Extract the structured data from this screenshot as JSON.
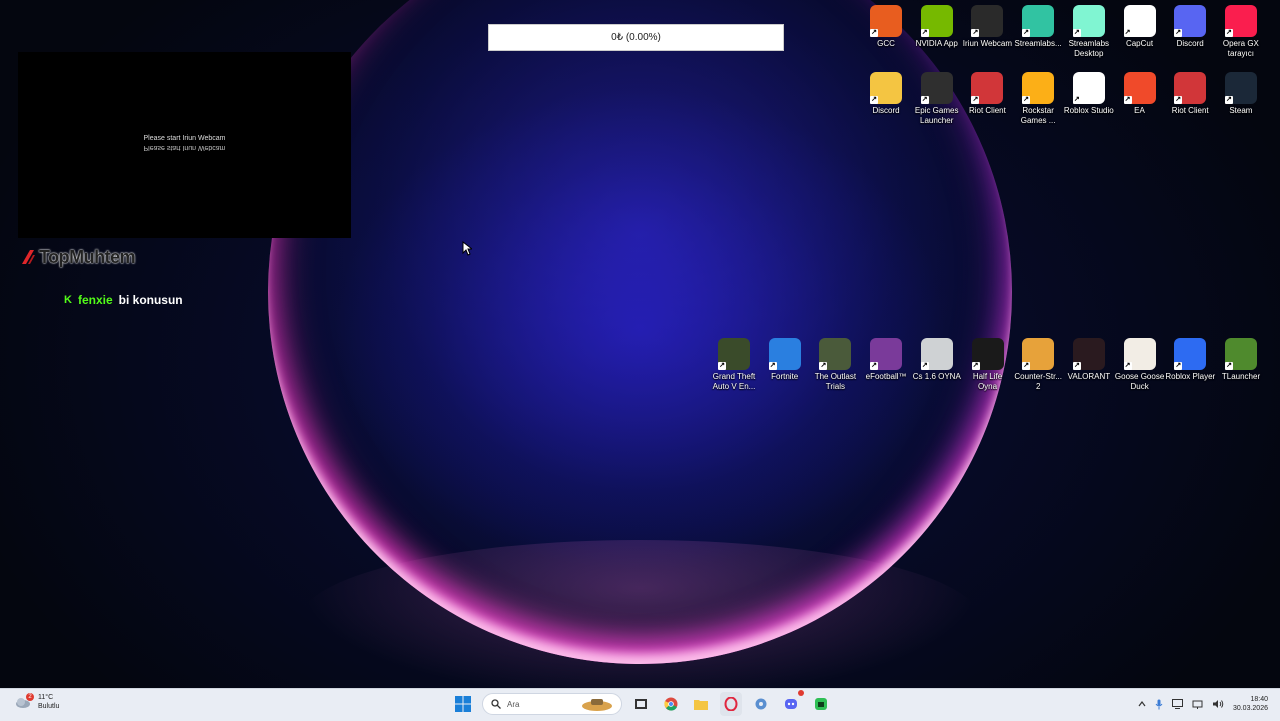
{
  "progress": {
    "text": "0₺ (0.00%)"
  },
  "webcam_overlay": {
    "message": "Please start Iriun Webcam"
  },
  "brand": {
    "name": "TopMuhtem"
  },
  "chat": {
    "username": "fenxie",
    "message": "bi konusun"
  },
  "desktop_icons_top": [
    {
      "label": "GCC",
      "icon": "gcc-icon",
      "color": "#e85d1f"
    },
    {
      "label": "NVIDIA App",
      "icon": "nvidia-icon",
      "color": "#76b900"
    },
    {
      "label": "Iriun Webcam",
      "icon": "iriun-webcam-icon",
      "color": "#2a2a2a"
    },
    {
      "label": "Streamlabs...",
      "icon": "streamlabs-icon",
      "color": "#31c3a2"
    },
    {
      "label": "Streamlabs Desktop",
      "icon": "streamlabs-desktop-icon",
      "color": "#80f5d2"
    },
    {
      "label": "CapCut",
      "icon": "capcut-icon",
      "color": "#ffffff"
    },
    {
      "label": "Discord",
      "icon": "discord-icon",
      "color": "#5865f2"
    },
    {
      "label": "Opera GX tarayıcı",
      "icon": "opera-gx-icon",
      "color": "#fa1e4e"
    }
  ],
  "desktop_icons_row2": [
    {
      "label": "Discord",
      "icon": "folder-icon",
      "color": "#f4c542"
    },
    {
      "label": "Epic Games Launcher",
      "icon": "epic-games-icon",
      "color": "#2f2f2f"
    },
    {
      "label": "Riot Client",
      "icon": "riot-client-icon",
      "color": "#d13639"
    },
    {
      "label": "Rockstar Games ...",
      "icon": "rockstar-icon",
      "color": "#fcaf17"
    },
    {
      "label": "Roblox Studio",
      "icon": "roblox-studio-icon",
      "color": "#ffffff"
    },
    {
      "label": "EA",
      "icon": "ea-icon",
      "color": "#f04a2a"
    },
    {
      "label": "Riot Client",
      "icon": "riot-client-icon",
      "color": "#d13639"
    },
    {
      "label": "Steam",
      "icon": "steam-icon",
      "color": "#1b2838"
    }
  ],
  "desktop_icons_games": [
    {
      "label": "Grand Theft Auto V En...",
      "icon": "gta5-icon",
      "color": "#3a4b2a"
    },
    {
      "label": "Fortnite",
      "icon": "fortnite-icon",
      "color": "#2a7fe0"
    },
    {
      "label": "The Outlast Trials",
      "icon": "outlast-icon",
      "color": "#4a5a3a"
    },
    {
      "label": "eFootball™",
      "icon": "efootball-icon",
      "color": "#7a3a9a"
    },
    {
      "label": "Cs 1.6 OYNA",
      "icon": "cs16-icon",
      "color": "#cfd2d4"
    },
    {
      "label": "Half Life Oyna",
      "icon": "half-life-icon",
      "color": "#1a1a1a"
    },
    {
      "label": "Counter-Str... 2",
      "icon": "cs2-icon",
      "color": "#e7a23a"
    },
    {
      "label": "VALORANT",
      "icon": "valorant-icon",
      "color": "#2a1a1f"
    },
    {
      "label": "Goose Goose Duck",
      "icon": "goose-goose-duck-icon",
      "color": "#f2ede5"
    },
    {
      "label": "Roblox Player",
      "icon": "roblox-player-icon",
      "color": "#2d6bf2"
    },
    {
      "label": "TLauncher",
      "icon": "tlauncher-icon",
      "color": "#4f8a2d"
    }
  ],
  "taskbar": {
    "weather": {
      "temp": "11°C",
      "condition": "Bulutlu",
      "badge": "2"
    },
    "search_placeholder": "Ara",
    "apps": [
      "windows-start-icon",
      "file-explorer-icon",
      "chrome-icon",
      "folder-icon",
      "opera-gx-icon",
      "settings-icon",
      "discord-icon",
      "app-green-icon"
    ],
    "clock": {
      "time": "18:40",
      "date": "30.03.2026"
    }
  }
}
